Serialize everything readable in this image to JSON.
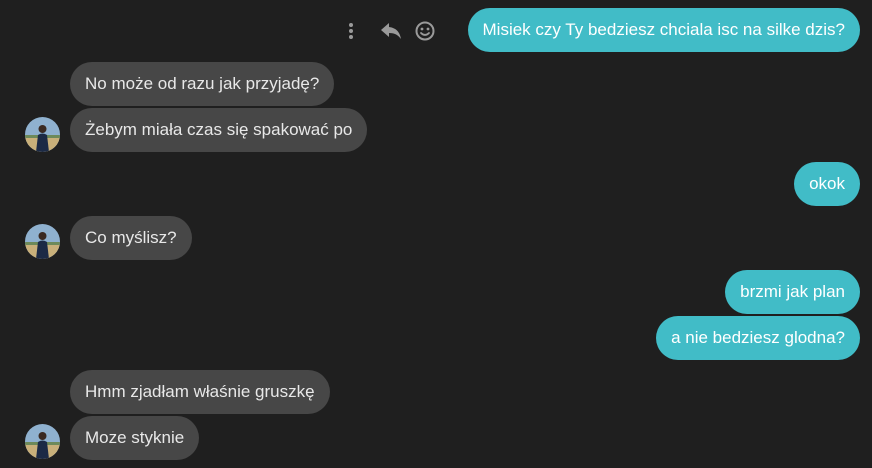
{
  "messages": [
    {
      "direction": "outgoing",
      "text": "Misiek czy Ty bedziesz chciala isc na silke dzis?"
    },
    {
      "direction": "incoming",
      "text": "No może od razu jak przyjadę?"
    },
    {
      "direction": "incoming",
      "text": "Żebym miała czas się spakować po"
    },
    {
      "direction": "outgoing",
      "text": "okok"
    },
    {
      "direction": "incoming",
      "text": "Co myślisz?"
    },
    {
      "direction": "outgoing",
      "text": "brzmi jak plan"
    },
    {
      "direction": "outgoing",
      "text": "a nie bedziesz glodna?"
    },
    {
      "direction": "incoming",
      "text": "Hmm zjadłam właśnie gruszkę"
    },
    {
      "direction": "incoming",
      "text": "Moze styknie"
    }
  ],
  "message_actions": [
    "more-options-icon",
    "reply-icon",
    "emoji-reaction-icon"
  ],
  "colors": {
    "background": "#1f1f1f",
    "incoming_bubble": "#474747",
    "outgoing_bubble": "#41bcc7",
    "icon": "#9a9a9a"
  }
}
